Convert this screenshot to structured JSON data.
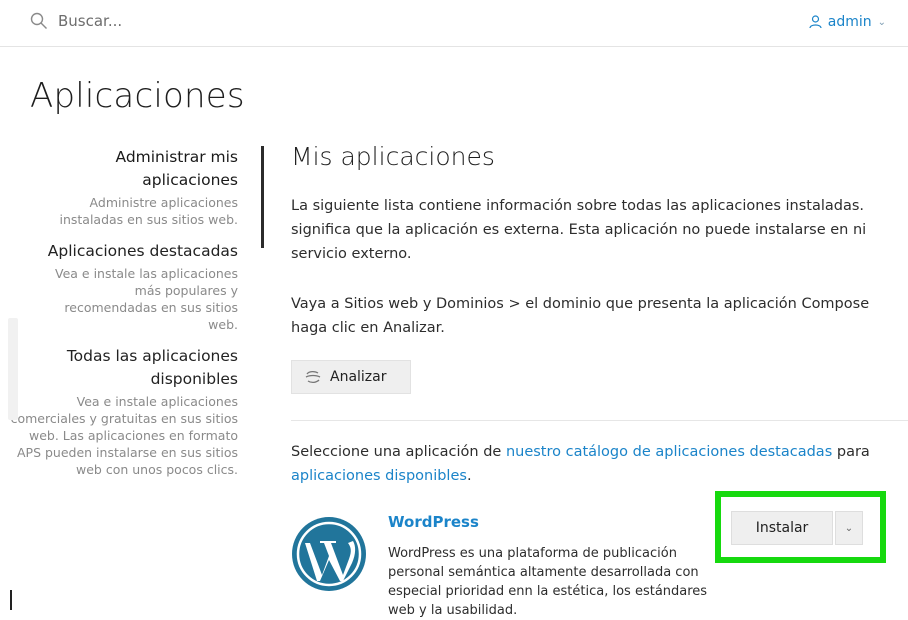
{
  "search": {
    "placeholder": "Buscar...",
    "icon": "search-icon"
  },
  "user": {
    "name": "admin",
    "icon": "user-icon"
  },
  "page": {
    "title": "Aplicaciones"
  },
  "sidebar": {
    "items": [
      {
        "title": "Administrar mis aplicaciones",
        "desc": "Administre aplicaciones instaladas en sus sitios web.",
        "active": true
      },
      {
        "title": "Aplicaciones destacadas",
        "desc": "Vea e instale las aplicaciones más populares y recomendadas en sus sitios web."
      },
      {
        "title": "Todas las aplicaciones disponibles",
        "desc": "Vea e instale aplicaciones comerciales y gratuitas en sus sitios web. Las aplicaciones en formato APS pueden instalarse en sus sitios web con unos pocos clics."
      }
    ]
  },
  "main": {
    "title": "Mis aplicaciones",
    "para1": {
      "line1": "La siguiente lista contiene información sobre todas las aplicaciones instaladas.",
      "line2": "significa que la aplicación es externa. Esta aplicación no puede instalarse en ni",
      "line3": "servicio externo."
    },
    "para2": {
      "line1": "Vaya a Sitios web y Dominios > el dominio que presenta la aplicación Compose",
      "line2": "haga clic en Analizar."
    },
    "analyze_label": "Analizar",
    "catalog": {
      "prefix": "Seleccione una aplicación de ",
      "link1": "nuestro catálogo de aplicaciones destacadas",
      "middle": " para",
      "link2": "aplicaciones disponibles",
      "suffix": "."
    },
    "app": {
      "name": "WordPress",
      "desc": "WordPress es una plataforma de publicación personal semántica altamente desarrollada con especial prioridad enn la estética, los estándares web y la usabilidad.",
      "install_label": "Instalar"
    }
  },
  "colors": {
    "accent": "#1b84c9",
    "highlight": "#16d90e"
  }
}
